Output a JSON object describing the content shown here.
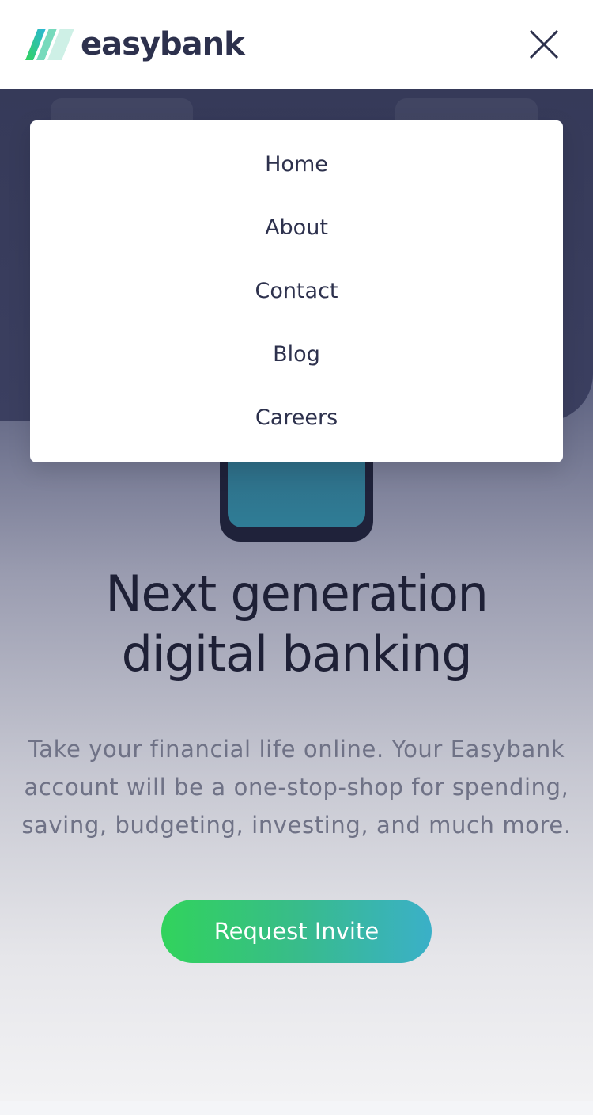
{
  "brand": {
    "name": "easybank",
    "colors": {
      "primary": "#2d314d",
      "green": "#31d35c",
      "cyan": "#3ab0c8"
    }
  },
  "header": {
    "close_icon": "close-icon"
  },
  "menu": {
    "items": [
      {
        "label": "Home"
      },
      {
        "label": "About"
      },
      {
        "label": "Contact"
      },
      {
        "label": "Blog"
      },
      {
        "label": "Careers"
      }
    ]
  },
  "hero": {
    "title_line1": "Next generation",
    "title_line2": "digital banking",
    "text": "Take your financial life online. Your Easybank account will be a one-stop-shop for spending, saving, budgeting, investing, and much more.",
    "cta_label": "Request Invite"
  }
}
